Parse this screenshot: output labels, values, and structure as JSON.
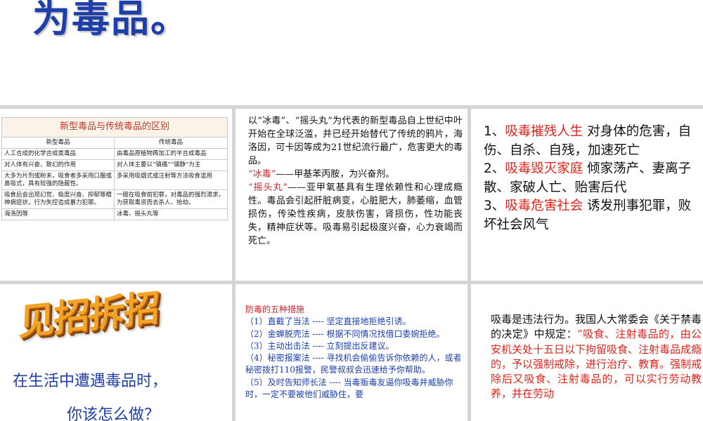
{
  "title": "为毒品。",
  "table": {
    "caption": "新型毒品与传统毒品的区别",
    "headers": [
      "新型毒品",
      "传统毒品"
    ],
    "rows": [
      [
        "人工合成的化学合成类毒品",
        "由毒品原植物再加工的半合成毒品"
      ],
      [
        "对人体有兴奋、致幻的作用",
        "对人体主要以“镇痛”“镇静”为主"
      ],
      [
        "大多为片剂或粉末，吸食者多采用口服或鼻吸式，具有较强的隐蔽性。",
        "多采用吸烟式或注射等方法吸食滥用"
      ],
      [
        "吸食后会出现幻觉、极度兴奋、抑郁等精神病症状，行为失控造成暴力犯罪。",
        "一般在吸食前犯罪，对毒品的强烈渴求，为获取毒资而去杀人、抢劫。"
      ],
      [
        "海洛因等",
        "冰毒、摇头丸等"
      ]
    ]
  },
  "panel2": {
    "intro": "以“冰毒”、“摇头丸”为代表的新型毒品自上世纪中叶开始在全球泛滥，并已经开始替代了传统的鸦片，海洛因，可卡因等成为21世纪流行最广，危害更大的毒品。",
    "ice_label": "“冰毒”",
    "ice_text": "——甲基苯丙胺，为兴奋剂。",
    "ecstasy_label": "“摇头丸”",
    "ecstasy_text": "——亚甲氧基具有生理依赖性和心理成瘾性。毒品会引起肝脏病变，心脏肥大，肺萎缩，血管损伤，传染性疾病，皮肤伤害，肾损伤，性功能丧失，精神症状等。吸毒易引起极度兴奋，心力衰竭而死亡。"
  },
  "panel3": {
    "items": [
      {
        "num": "1、",
        "title": "吸毒摧残人生",
        "text": " 对身体的危害，自伤、自杀、自残，加速死亡"
      },
      {
        "num": "2、",
        "title": "吸毒毁灭家庭",
        "text": " 倾家荡产、妻离子散、家破人亡、贻害后代"
      },
      {
        "num": "3、",
        "title": "吸毒危害社会",
        "text": " 诱发刑事犯罪，败坏社会风气"
      }
    ]
  },
  "panel4": {
    "art_title": "见招拆招",
    "question_1": "在生活中遭遇毒品时，",
    "question_2": "你该怎么做？"
  },
  "panel5": {
    "heading": "防毒的五种措施",
    "items": [
      "（1）直截了当法 ---- 坚定直接地拒绝引诱。",
      "（2）金蝉脱壳法 ---- 根据不同情况找借口委婉拒绝。",
      "（3）主动出击法 ---- 立刻提出反建议。",
      "（4）秘密报案法 ---- 寻找机会偷偷告诉你依赖的人，或者秘密拨打110报警，民警叔叔会迅速给予你帮助。",
      "（5）及时告知师长法 ---- 当毒贩毒友逼你吸毒并威胁你时，一定不要被他们威胁住，要"
    ]
  },
  "panel6": {
    "intro": "吸毒是违法行为。我国人大常委会《关于禁毒的决定》中规定：",
    "quote": "“吸食、注射毒品的，由公安机关处十五日以下拘留吸食、注射毒品成瘾的，予以强制戒除，进行治疗、教育。强制戒除后又吸食、注射毒品的，可以实行劳动教养，并在劳动"
  }
}
